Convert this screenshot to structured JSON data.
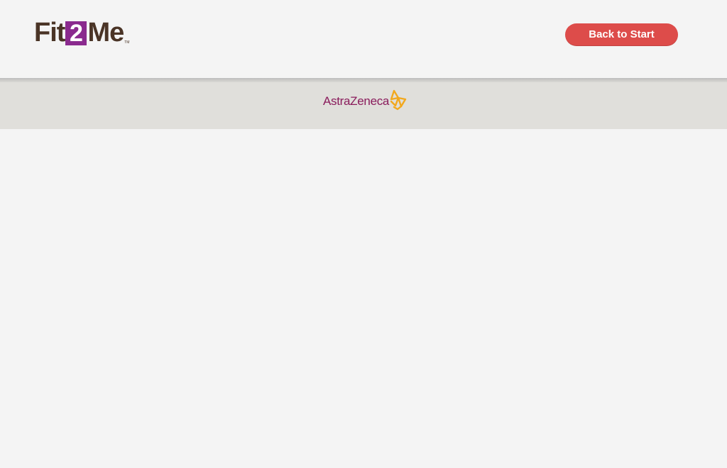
{
  "header": {
    "logo": {
      "prefix": "Fit",
      "number": "2",
      "suffix": "Me",
      "trademark": "TM"
    },
    "back_button_label": "Back to Start"
  },
  "sponsor": {
    "name": "AstraZeneca",
    "mark_icon": "astrazeneca-symbol-icon"
  },
  "colors": {
    "brand_brown": "#4a3426",
    "brand_purple": "#8a2a8e",
    "button_red": "#dd4c4a",
    "sponsor_magenta": "#8a1c5c",
    "sponsor_gold": "#f2a81d"
  }
}
